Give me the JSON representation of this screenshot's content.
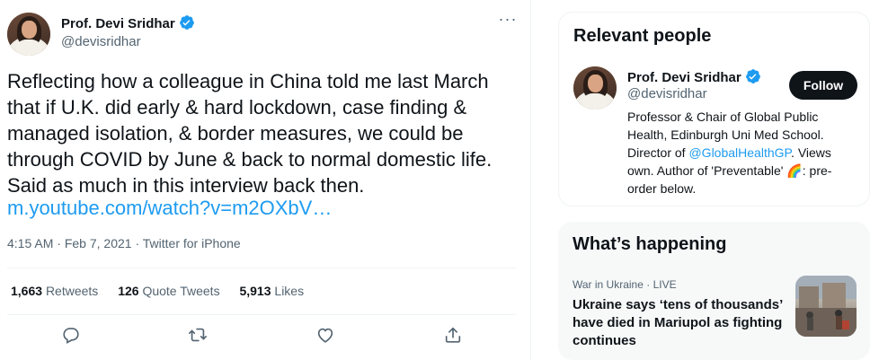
{
  "tweet": {
    "author_name": "Prof. Devi Sridhar",
    "author_handle": "@devisridhar",
    "more_label": "···",
    "text": "Reflecting how a colleague in China told me last March\nthat if U.K. did early & hard lockdown, case finding &\nmanaged isolation, & border measures, we could be\nthrough COVID by June & back to normal domestic life.\nSaid as much in this interview back then.",
    "link_text": "m.youtube.com/watch?v=m2OXbV…",
    "time": "4:15 AM",
    "date": "Feb 7, 2021",
    "source": "Twitter for iPhone",
    "stats": {
      "retweets_count": "1,663",
      "retweets_label": "Retweets",
      "quotes_count": "126",
      "quotes_label": "Quote Tweets",
      "likes_count": "5,913",
      "likes_label": "Likes"
    },
    "actions": [
      "reply-icon",
      "retweet-icon",
      "like-icon",
      "share-icon"
    ]
  },
  "sidebar": {
    "relevant_people": {
      "title": "Relevant people",
      "name": "Prof. Devi Sridhar",
      "handle": "@devisridhar",
      "follow_label": "Follow",
      "bio_before": "Professor & Chair of Global Public Health, Edinburgh Uni Med School. Director of ",
      "bio_mention": "@GlobalHealthGP",
      "bio_after": ". Views own. Author of 'Preventable' 🌈: pre-order below."
    },
    "happening": {
      "title": "What’s happening",
      "category": "War in Ukraine · LIVE",
      "headline": "Ukraine says ‘tens of thousands’ have died in Mariupol as fighting continues"
    }
  },
  "colors": {
    "accent": "#1d9bf0",
    "text": "#0f1419",
    "muted": "#536471",
    "follow_bg": "#0f1419"
  }
}
